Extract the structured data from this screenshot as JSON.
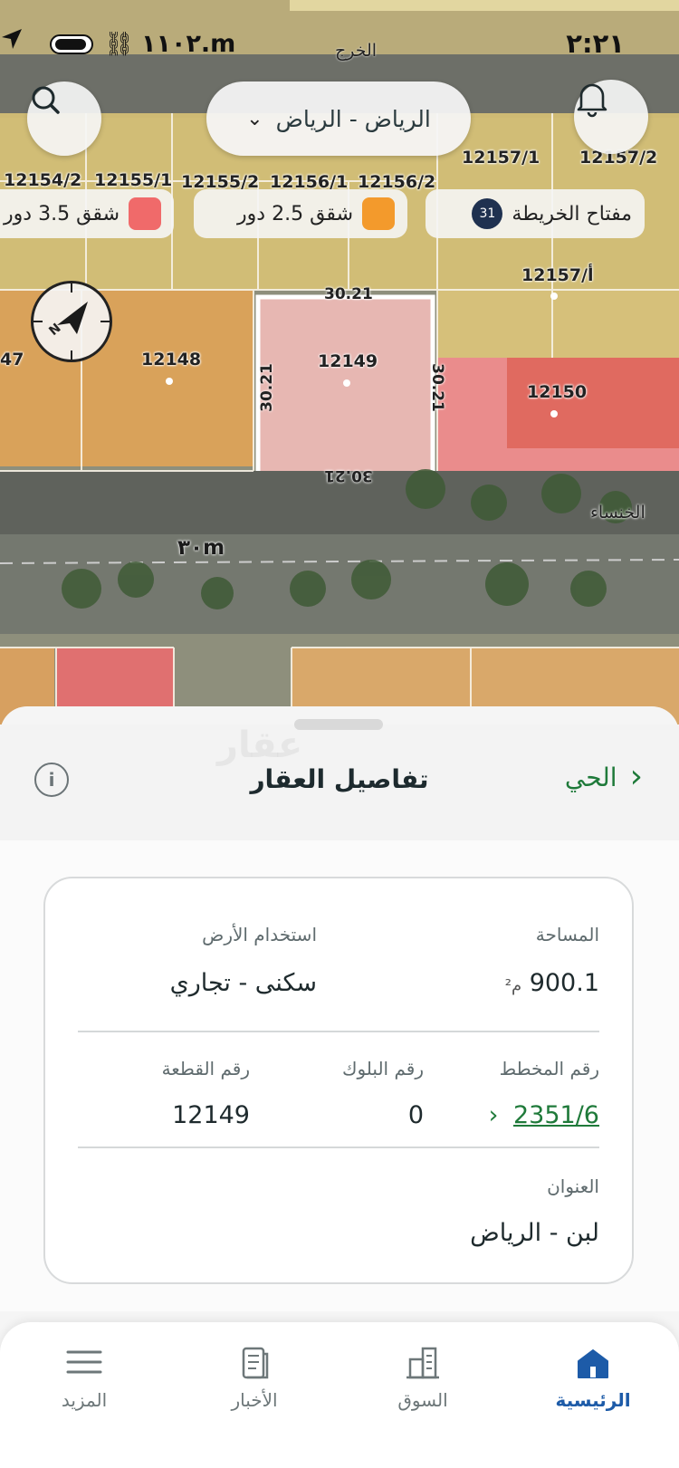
{
  "status_bar": {
    "time": "٢:٢١",
    "speed": "١١٠٢.m",
    "street_top": "الخرج"
  },
  "map": {
    "city_selector": "الرياض - الرياض",
    "legend": [
      {
        "label": "مفتاح الخريطة",
        "badge": "31"
      },
      {
        "label": "شقق 2.5 دور",
        "color": "#f39a2c"
      },
      {
        "label": "شقق 3.5 دور",
        "color": "#f06a6a"
      }
    ],
    "plots": [
      "12154/2",
      "12155/1",
      "12155/2",
      "12156/1",
      "12156/2",
      "12157/1",
      "12157/2",
      "12157/أ",
      "12148",
      "12149",
      "12150",
      "47"
    ],
    "selected_plot_dims": {
      "top": "30.21",
      "left": "30.21",
      "right": "30.21",
      "bottom": "30.21"
    },
    "street_name": "الخنساء",
    "street_width": "٣٠m"
  },
  "sheet": {
    "title": "تفاصيل العقار",
    "district_link": "الحي",
    "watermark": "عقار",
    "fields": {
      "area_label": "المساحة",
      "area_value": "900.1",
      "area_unit": "م²",
      "land_use_label": "استخدام الأرض",
      "land_use_value": "سكنى - تجاري",
      "plan_label": "رقم المخطط",
      "plan_value": "2351/6",
      "block_label": "رقم البلوك",
      "block_value": "0",
      "plot_label": "رقم القطعة",
      "plot_value": "12149",
      "address_label": "العنوان",
      "address_value": "لبن - الرياض"
    }
  },
  "bottom_nav": [
    {
      "label": "الرئيسية",
      "icon": "home-icon",
      "active": true
    },
    {
      "label": "السوق",
      "icon": "building-icon",
      "active": false
    },
    {
      "label": "الأخبار",
      "icon": "news-icon",
      "active": false
    },
    {
      "label": "المزيد",
      "icon": "menu-icon",
      "active": false
    }
  ],
  "colors": {
    "accent_green": "#1f7a3a",
    "nav_active": "#1d5ba8"
  }
}
